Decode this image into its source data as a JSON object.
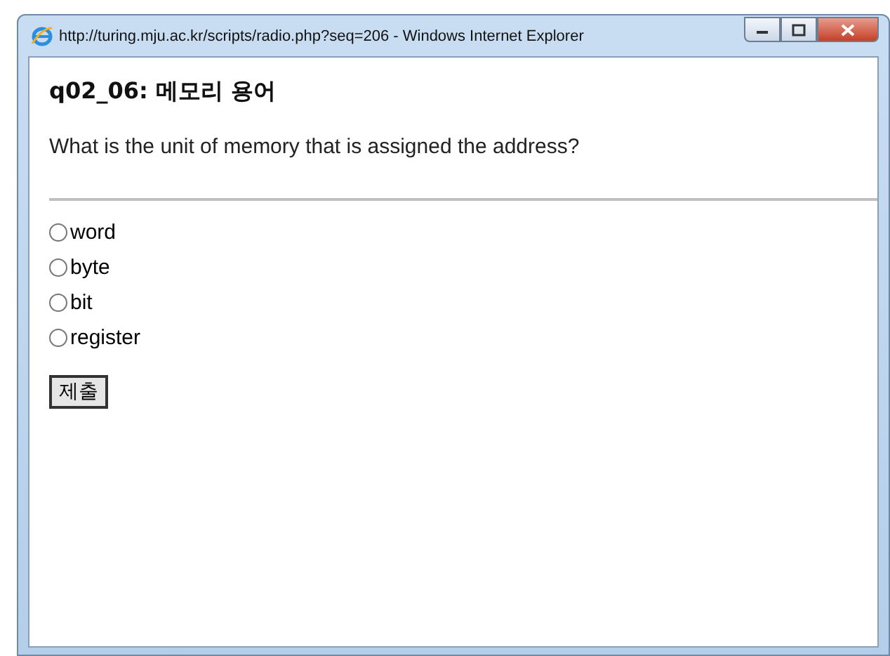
{
  "window": {
    "title": "http://turing.mju.ac.kr/scripts/radio.php?seq=206 - Windows Internet Explorer"
  },
  "heading": "q02_06: 메모리 용어",
  "question": "What is the unit of memory that is assigned the address?",
  "options": [
    {
      "label": "word",
      "selected": false
    },
    {
      "label": "byte",
      "selected": false
    },
    {
      "label": "bit",
      "selected": false
    },
    {
      "label": "register",
      "selected": false
    }
  ],
  "submit_button": "제출"
}
